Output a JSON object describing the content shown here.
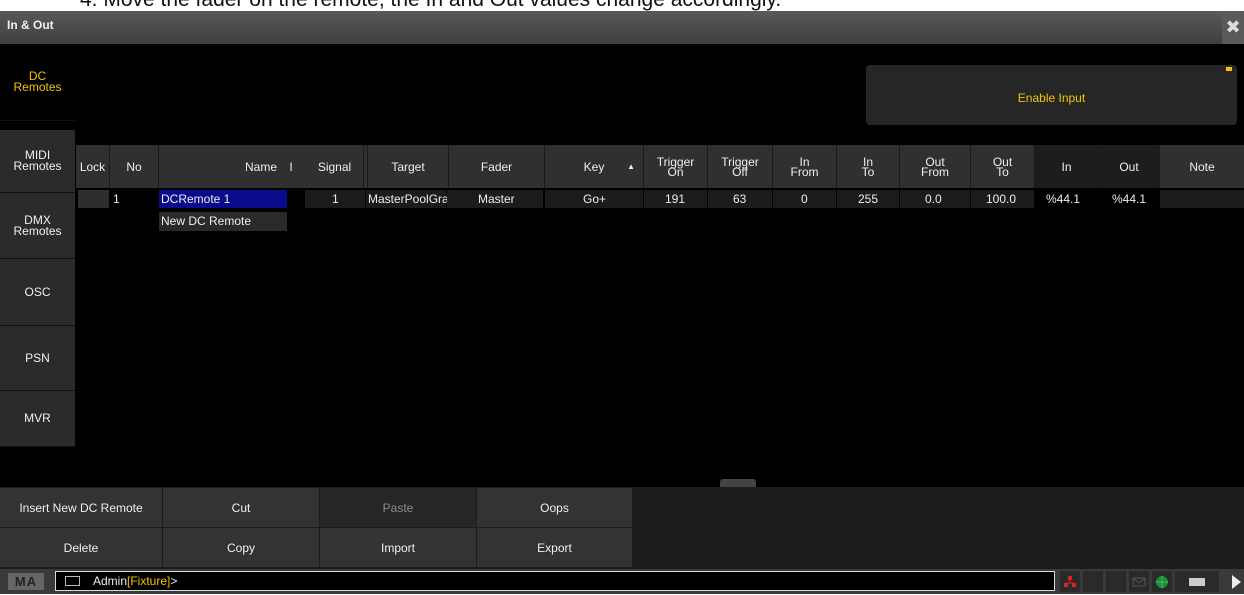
{
  "caption": "4.   Move the fader on the remote, the In and Out values change accordingly.",
  "window": {
    "title": "In & Out",
    "close_symbol": "✖"
  },
  "sidebar": {
    "items": [
      {
        "line1": "DC",
        "line2": "Remotes",
        "active": true
      },
      {
        "line1": "MIDI",
        "line2": "Remotes",
        "active": false
      },
      {
        "line1": "DMX",
        "line2": "Remotes",
        "active": false
      },
      {
        "line1": "OSC",
        "line2": "",
        "active": false
      },
      {
        "line1": "PSN",
        "line2": "",
        "active": false
      },
      {
        "line1": "MVR",
        "line2": "",
        "active": false
      }
    ]
  },
  "enable_input": {
    "label": "Enable Input"
  },
  "table": {
    "columns": [
      {
        "l1": "Lock",
        "l2": ""
      },
      {
        "l1": "No",
        "l2": ""
      },
      {
        "l1": "Name",
        "l2": ""
      },
      {
        "l1": "I",
        "l2": ""
      },
      {
        "l1": "Signal",
        "l2": ""
      },
      {
        "l1": "Target",
        "l2": ""
      },
      {
        "l1": "Fader",
        "l2": ""
      },
      {
        "l1": "Key",
        "l2": "",
        "sort": "▲"
      },
      {
        "l1": "Trigger",
        "l2": "On"
      },
      {
        "l1": "Trigger",
        "l2": "Off"
      },
      {
        "l1": "In",
        "l2": "From"
      },
      {
        "l1": "In",
        "l2": "To"
      },
      {
        "l1": "Out",
        "l2": "From"
      },
      {
        "l1": "Out",
        "l2": "To"
      },
      {
        "l1": "In",
        "l2": ""
      },
      {
        "l1": "Out",
        "l2": ""
      },
      {
        "l1": "Note",
        "l2": ""
      }
    ],
    "rows": [
      {
        "lock": "",
        "no": "1",
        "name": "DCRemote 1",
        "signal": "1",
        "target": "MasterPoolGra",
        "fader": "Master",
        "key": "Go+",
        "trigger_on": "191",
        "trigger_off": "63",
        "in_from": "0",
        "in_to": "255",
        "out_from": "0.0",
        "out_to": "100.0",
        "in": "%44.1",
        "out": "%44.1",
        "note": ""
      },
      {
        "new_label": "New DC Remote"
      }
    ]
  },
  "buttons": {
    "insert": "Insert New DC Remote",
    "cut": "Cut",
    "paste": "Paste",
    "oops": "Oops",
    "delete": "Delete",
    "copy": "Copy",
    "import": "Import",
    "export": "Export"
  },
  "command_line": {
    "logo": "MA",
    "user": "Admin",
    "context": "[Fixture]",
    "suffix": ">"
  },
  "colors": {
    "accent": "#f2c300",
    "selection": "#0a0a8c",
    "panel": "#303030"
  }
}
